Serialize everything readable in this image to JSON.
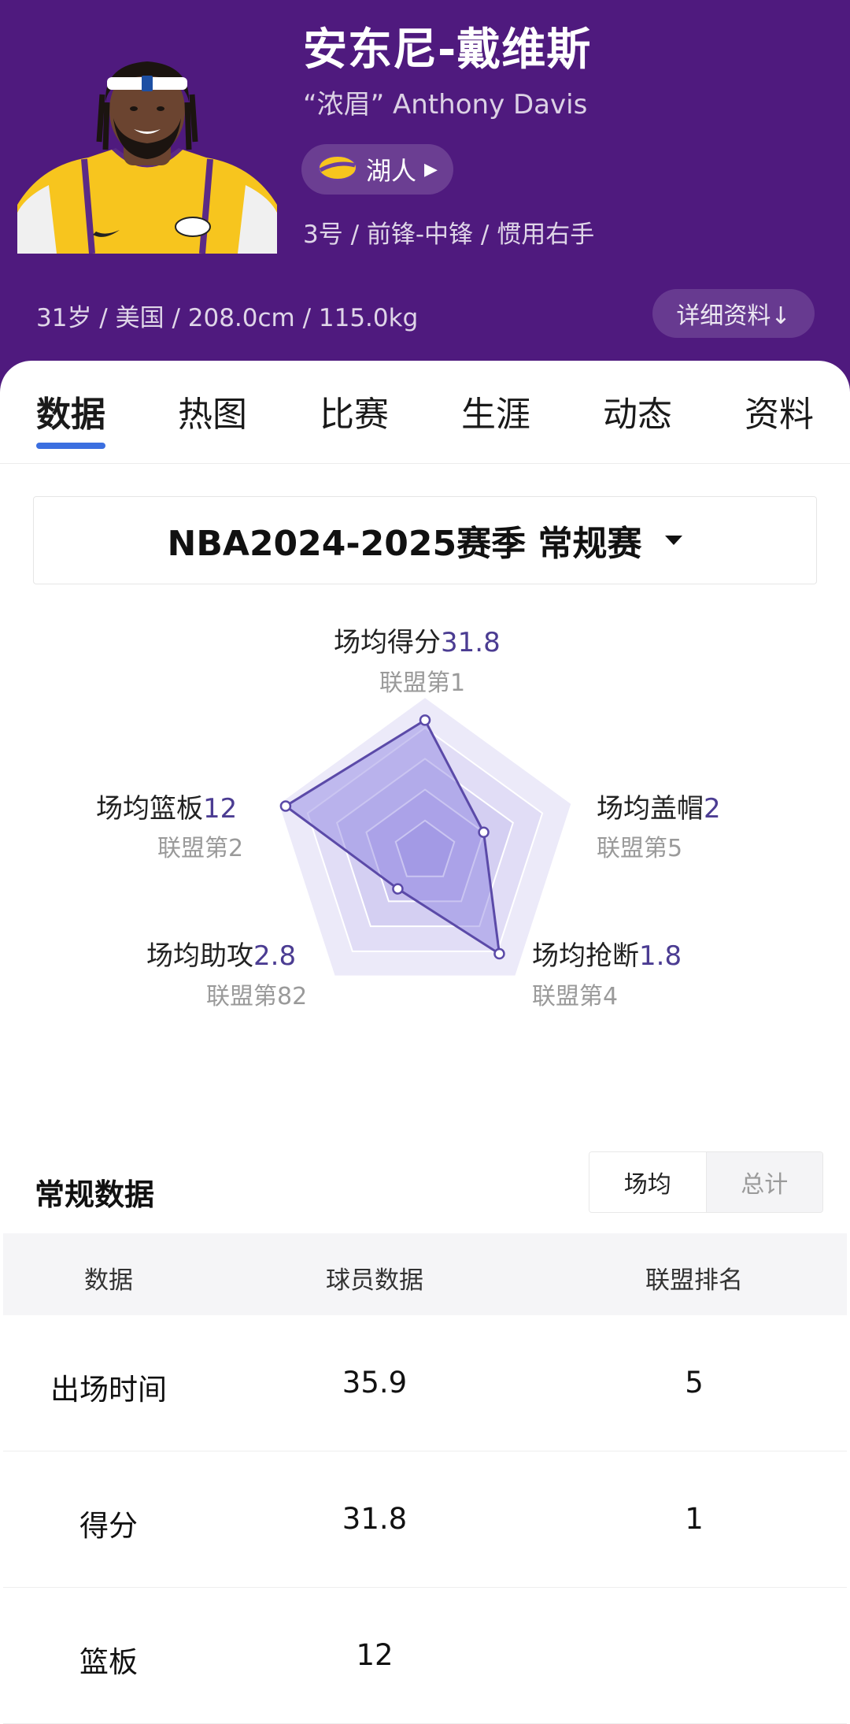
{
  "player": {
    "name": "安东尼-戴维斯",
    "nickname": "“浓眉” Anthony Davis",
    "team": "湖人",
    "meta": "3号 / 前锋-中锋 / 惯用右手",
    "bio": "31岁 / 美国 / 208.0cm / 115.0kg",
    "detail_button": "详细资料↓"
  },
  "tabs": [
    {
      "label": "数据",
      "active": true
    },
    {
      "label": "热图",
      "active": false
    },
    {
      "label": "比赛",
      "active": false
    },
    {
      "label": "生涯",
      "active": false
    },
    {
      "label": "动态",
      "active": false
    },
    {
      "label": "资料",
      "active": false
    }
  ],
  "season_selector": {
    "label": "NBA2024-2025赛季 常规赛"
  },
  "radar": {
    "stats": [
      {
        "label": "场均得分",
        "value": "31.8",
        "rank": "联盟第1",
        "norm": 0.85
      },
      {
        "label": "场均盖帽",
        "value": "2",
        "rank": "联盟第5",
        "norm": 0.4
      },
      {
        "label": "场均抢断",
        "value": "1.8",
        "rank": "联盟第4",
        "norm": 0.82
      },
      {
        "label": "场均助攻",
        "value": "2.8",
        "rank": "联盟第82",
        "norm": 0.3
      },
      {
        "label": "场均篮板",
        "value": "12",
        "rank": "联盟第2",
        "norm": 0.95
      }
    ],
    "colors": {
      "line": "#5b4aa8",
      "fill": "#8a7ee0"
    }
  },
  "regular_data": {
    "title": "常规数据",
    "toggle": [
      {
        "label": "场均",
        "active": true
      },
      {
        "label": "总计",
        "active": false
      }
    ],
    "headers": [
      "数据",
      "球员数据",
      "联盟排名"
    ],
    "rows": [
      [
        "出场时间",
        "35.9",
        "5"
      ],
      [
        "得分",
        "31.8",
        "1"
      ],
      [
        "篮板",
        "12",
        ""
      ]
    ]
  },
  "colors": {
    "header_bg": "#4f1a7e",
    "tab_active_underline": "#3b6fe0",
    "stat_value": "#4b3c92"
  }
}
